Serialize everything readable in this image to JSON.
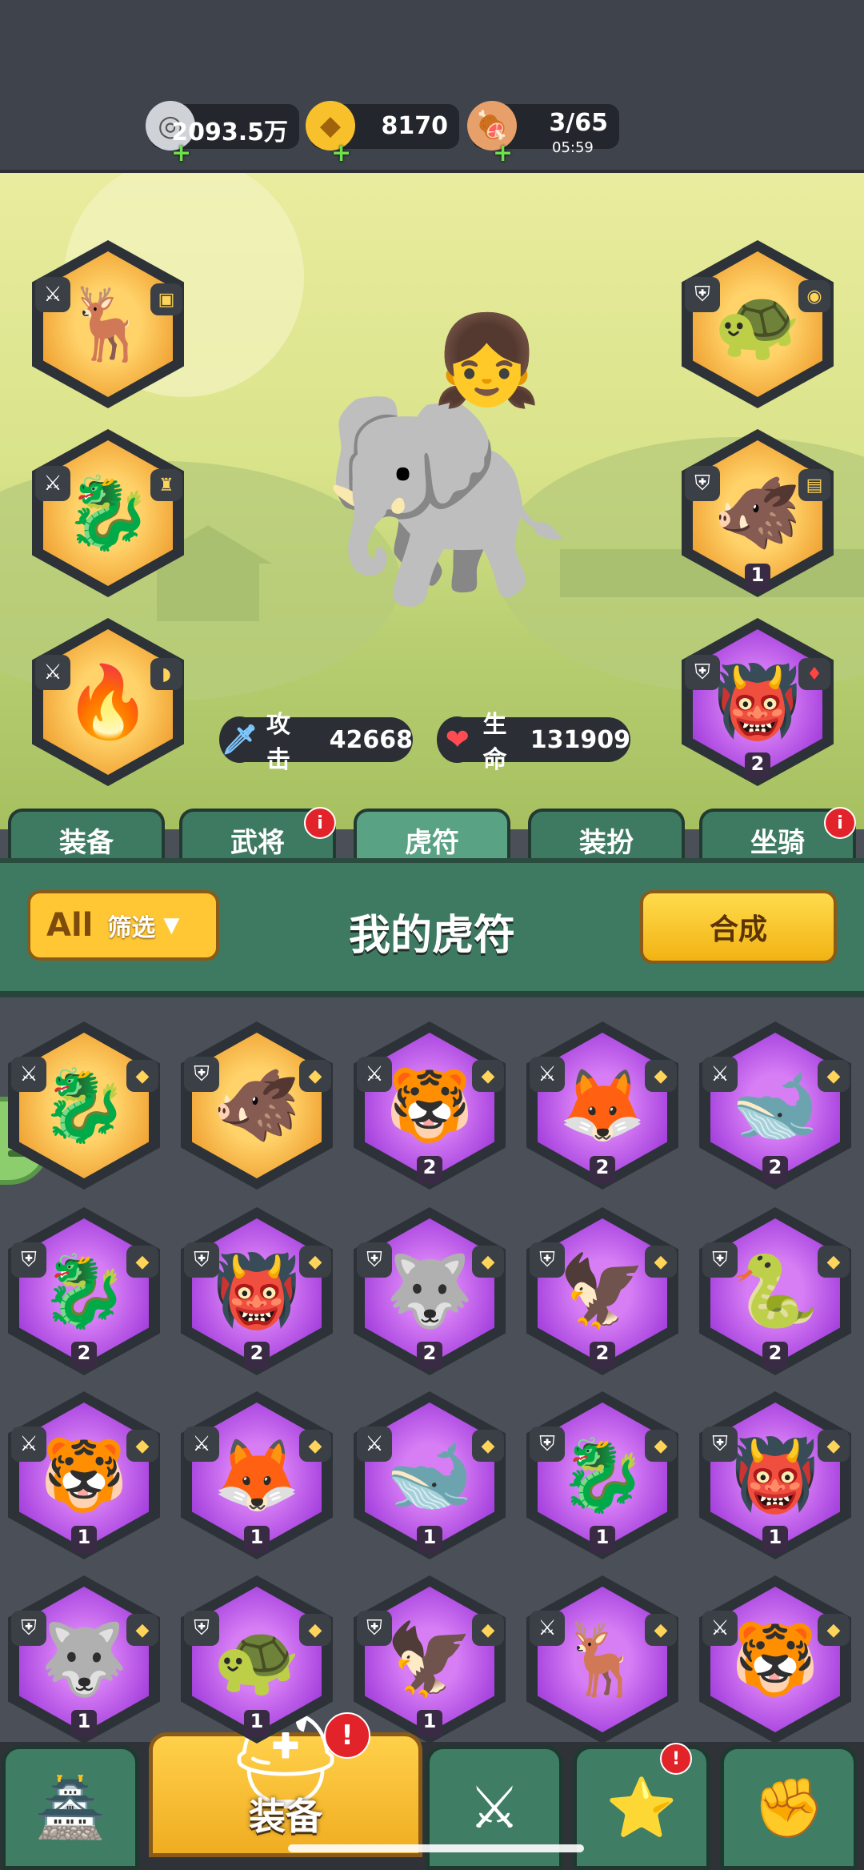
{
  "resources": [
    {
      "name": "silver",
      "icon": "coin-icon",
      "value": "2093.5万"
    },
    {
      "name": "gold-ingot",
      "icon": "ingot-icon",
      "value": "8170"
    },
    {
      "name": "stamina",
      "icon": "meat-icon",
      "value": "3/65",
      "timer": "05:59"
    }
  ],
  "stats": {
    "attack_label": "攻击",
    "attack_value": "42668",
    "life_label": "生命",
    "life_value": "131909"
  },
  "equipped": {
    "left": [
      {
        "emblem": "🦌",
        "tier": "gold",
        "lvl": ""
      },
      {
        "emblem": "🐉",
        "tier": "gold",
        "lvl": ""
      },
      {
        "emblem": "🔥",
        "tier": "gold",
        "lvl": ""
      }
    ],
    "right": [
      {
        "emblem": "🐢",
        "tier": "gold",
        "lvl": ""
      },
      {
        "emblem": "🐗",
        "tier": "gold",
        "lvl": "1"
      },
      {
        "emblem": "👹",
        "tier": "purple",
        "lvl": "2"
      }
    ]
  },
  "tabs": [
    {
      "label": "装备",
      "alert": false
    },
    {
      "label": "武将",
      "alert": true
    },
    {
      "label": "虎符",
      "alert": false,
      "active": true
    },
    {
      "label": "装扮",
      "alert": false
    },
    {
      "label": "坐骑",
      "alert": true
    }
  ],
  "panel": {
    "filter_all": "All",
    "filter_label": "筛选",
    "title": "我的虎符",
    "merge_label": "合成"
  },
  "inventory": [
    {
      "emblem": "🐉",
      "tier": "gold",
      "lvl": ""
    },
    {
      "emblem": "🐗",
      "tier": "gold",
      "lvl": ""
    },
    {
      "emblem": "🐯",
      "tier": "purple",
      "lvl": "2"
    },
    {
      "emblem": "🦊",
      "tier": "purple",
      "lvl": "2"
    },
    {
      "emblem": "🐋",
      "tier": "purple",
      "lvl": "2"
    },
    {
      "emblem": "🐉",
      "tier": "purple",
      "lvl": "2"
    },
    {
      "emblem": "👹",
      "tier": "purple",
      "lvl": "2"
    },
    {
      "emblem": "🐺",
      "tier": "purple",
      "lvl": "2"
    },
    {
      "emblem": "🦅",
      "tier": "purple",
      "lvl": "2"
    },
    {
      "emblem": "🐍",
      "tier": "purple",
      "lvl": "2"
    },
    {
      "emblem": "🐯",
      "tier": "purple",
      "lvl": "1"
    },
    {
      "emblem": "🦊",
      "tier": "purple",
      "lvl": "1"
    },
    {
      "emblem": "🐋",
      "tier": "purple",
      "lvl": "1"
    },
    {
      "emblem": "🐉",
      "tier": "purple",
      "lvl": "1"
    },
    {
      "emblem": "👹",
      "tier": "purple",
      "lvl": "1"
    },
    {
      "emblem": "🐺",
      "tier": "purple",
      "lvl": "1"
    },
    {
      "emblem": "🐢",
      "tier": "purple",
      "lvl": "1"
    },
    {
      "emblem": "🦅",
      "tier": "purple",
      "lvl": "1"
    },
    {
      "emblem": "🦌",
      "tier": "purple",
      "lvl": ""
    },
    {
      "emblem": "🐯",
      "tier": "purple",
      "lvl": ""
    }
  ],
  "dock": [
    {
      "icon": "castle-icon",
      "label": ""
    },
    {
      "icon": "helmet-icon",
      "label": "装备",
      "active": true,
      "alert": "!"
    },
    {
      "icon": "shield-swords-icon",
      "label": ""
    },
    {
      "icon": "helm-stars-icon",
      "label": "",
      "alert": "!"
    },
    {
      "icon": "fist-icon",
      "label": ""
    }
  ]
}
